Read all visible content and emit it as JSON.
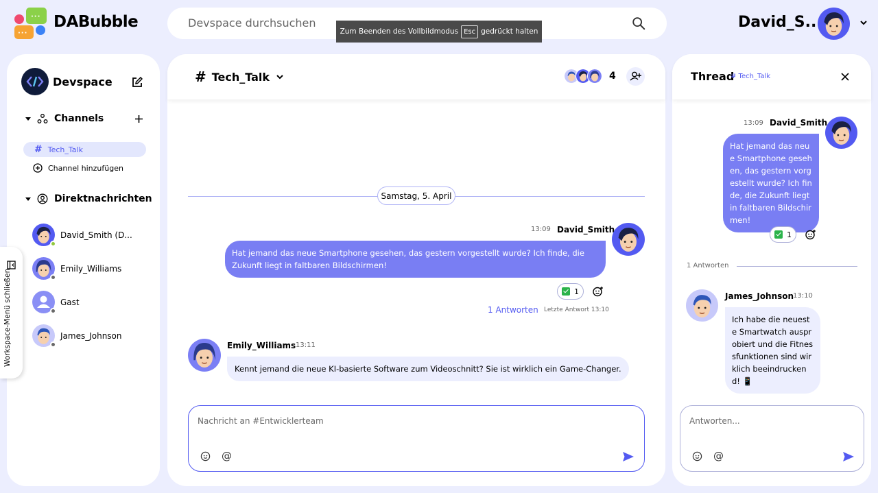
{
  "app": {
    "name": "DABubble"
  },
  "search": {
    "placeholder": "Devspace durchsuchen"
  },
  "fullscreen_hint": {
    "before": "Zum Beenden des Vollbildmodus",
    "key": "Esc",
    "after": "gedrückt halten"
  },
  "user": {
    "name": "David_S..."
  },
  "workspace": {
    "name": "Devspace"
  },
  "sidebar": {
    "channels_label": "Channels",
    "channels": [
      {
        "name": "Tech_Talk",
        "active": true
      }
    ],
    "add_channel_label": "Channel hinzufügen",
    "dm_label": "Direktnachrichten",
    "dms": [
      {
        "name": "David_Smith (D...",
        "status": "online"
      },
      {
        "name": "Emily_Williams",
        "status": "offline"
      },
      {
        "name": "Gast",
        "status": "offline"
      },
      {
        "name": "James_Johnson",
        "status": "offline"
      }
    ],
    "toggle_label": "Workspace-Menü schließen"
  },
  "channel": {
    "title": "Tech_Talk",
    "member_count": "4"
  },
  "chat": {
    "date_label": "Samstag, 5. April",
    "messages": [
      {
        "author": "David_Smith",
        "time": "13:09",
        "text": "Hat jemand das neue Smartphone gesehen, das gestern vorgestellt wurde? Ich finde, die Zukunft liegt in faltbaren Bildschirmen!",
        "reaction_count": "1",
        "replies_label": "1 Antworten",
        "last_reply_label": "Letzte Antwort 13:10"
      },
      {
        "author": "Emily_Williams",
        "time": "13:11",
        "text": "Kennt jemand die neue KI-basierte Software zum Videoschnitt? Sie ist wirklich ein Game-Changer."
      }
    ],
    "input_placeholder": "Nachricht an #Entwicklerteam"
  },
  "thread": {
    "title": "Thread",
    "channel": "# Tech_Talk",
    "original": {
      "author": "David_Smith",
      "time": "13:09",
      "text": "Hat jemand das neue Smartphone gesehen, das gestern vorgestellt wurde? Ich finde, die Zukunft liegt in faltbaren Bildschirmen!",
      "reaction_count": "1"
    },
    "replies_label": "1 Antworten",
    "reply": {
      "author": "James_Johnson",
      "time": "13:10",
      "text": "Ich habe die neueste Smartwatch ausprobiert und die Fitnessfunktionen sind wirklich beeindruckend! 📱"
    },
    "input_placeholder": "Antworten..."
  },
  "colors": {
    "accent": "#535af1",
    "bubble": "#797ef3",
    "background": "#eceefe",
    "online": "#92c83e"
  }
}
